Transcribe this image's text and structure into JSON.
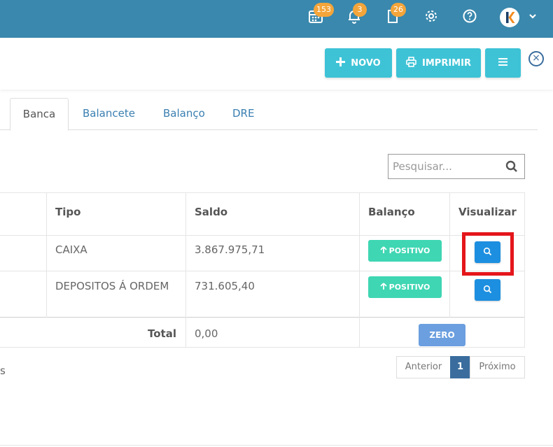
{
  "topbar": {
    "calendar_badge": "153",
    "bell_badge": "3",
    "doc_badge": "26",
    "calendar_icon": "calendar-icon",
    "bell_icon": "bell-icon",
    "doc_icon": "document-icon",
    "settings_icon": "gear-icon",
    "help_icon": "question-icon",
    "avatar_letter": "K"
  },
  "toolbar": {
    "new_label": "NOVO",
    "print_label": "IMPRIMIR",
    "close_symbol": "×"
  },
  "tabs": [
    {
      "label": "Banca",
      "active": true
    },
    {
      "label": "Balancete",
      "active": false
    },
    {
      "label": "Balanço",
      "active": false
    },
    {
      "label": "DRE",
      "active": false
    }
  ],
  "search": {
    "placeholder": "Pesquisar..."
  },
  "table": {
    "headers": {
      "tipo": "Tipo",
      "saldo": "Saldo",
      "balanco": "Balanço",
      "visualizar": "Visualizar"
    },
    "rows": [
      {
        "tipo": "CAIXA",
        "saldo": "3.867.975,71",
        "balanco": "POSITIVO"
      },
      {
        "tipo": "DEPOSITOS Á ORDEM",
        "saldo": "731.605,40",
        "balanco": "POSITIVO"
      }
    ],
    "total_label": "Total",
    "total_value": "0,00",
    "total_badge": "ZERO"
  },
  "footer": {
    "info_fragment": "s"
  },
  "pagination": {
    "prev": "Anterior",
    "current": "1",
    "next": "Próximo"
  },
  "colors": {
    "topbar": "#3a88ad",
    "accent": "#3ec3d6",
    "positive": "#3fd6b3",
    "view": "#1d8fe0",
    "highlight": "#e4161b",
    "badge": "#f4a53a"
  }
}
